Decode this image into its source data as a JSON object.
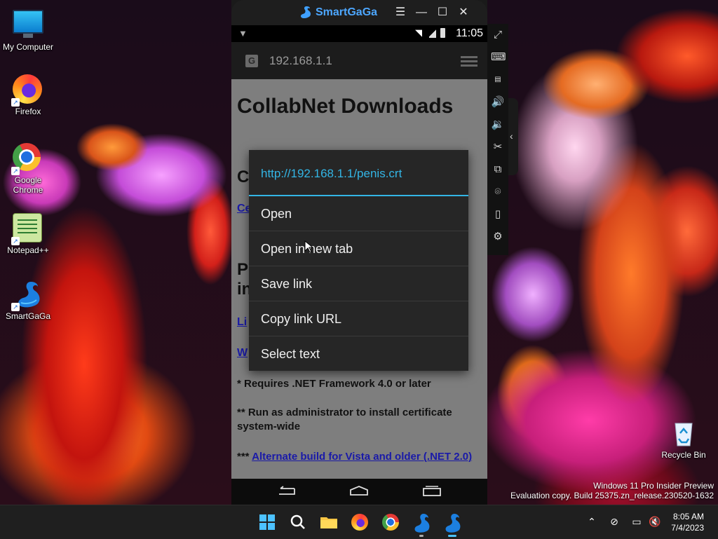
{
  "desktop": {
    "icons": [
      {
        "label": "My Computer"
      },
      {
        "label": "Firefox"
      },
      {
        "label": "Google Chrome"
      },
      {
        "label": "Notepad++"
      },
      {
        "label": "SmartGaGa"
      },
      {
        "label": "Recycle Bin"
      }
    ],
    "watermark_line1": "Windows 11 Pro Insider Preview",
    "watermark_line2": "Evaluation copy. Build 25375.zn_release.230520-1632"
  },
  "emulator": {
    "title": "SmartGaGa",
    "titlebar_buttons": [
      "menu",
      "minimize",
      "maximize",
      "close"
    ],
    "status_time": "11:05",
    "url": "192.168.1.1",
    "side_tools": [
      "fullscreen-icon",
      "keyboard-icon",
      "apk-install-icon",
      "volume-up-icon",
      "volume-down-icon",
      "screenshot-scissors-icon",
      "multi-instance-icon",
      "location-icon",
      "shake-icon",
      "settings-icon"
    ]
  },
  "webpage": {
    "heading": "CollabNet Downloads",
    "frag_c": "C",
    "frag_ce": "Ce",
    "frag_p": "P",
    "frag_in": "in",
    "frag_li": "Li",
    "frag_w": "W",
    "note1": "* Requires .NET Framework 4.0 or later",
    "note2": "** Run as administrator to install certificate system-wide",
    "note3_prefix": "***",
    "note3_link": "Alternate build for Vista and older (.NET 2.0)"
  },
  "context_menu": {
    "url": "http://192.168.1.1/penis.crt",
    "items": [
      {
        "label": "Open"
      },
      {
        "label": "Open in new tab"
      },
      {
        "label": "Save link"
      },
      {
        "label": "Copy link URL"
      },
      {
        "label": "Select text"
      }
    ]
  },
  "taskbar": {
    "apps": [
      "start-icon",
      "search-icon",
      "file-explorer-icon",
      "firefox-icon",
      "chrome-icon",
      "smartgaga-icon",
      "smartgaga-active-icon"
    ],
    "clock_time": "8:05 AM",
    "clock_date": "7/4/2023"
  },
  "colors": {
    "accent": "#33b5e5",
    "menu_bg": "#262626",
    "webview_bg": "#7e7e7e",
    "brand_blue": "#4da7ff"
  }
}
